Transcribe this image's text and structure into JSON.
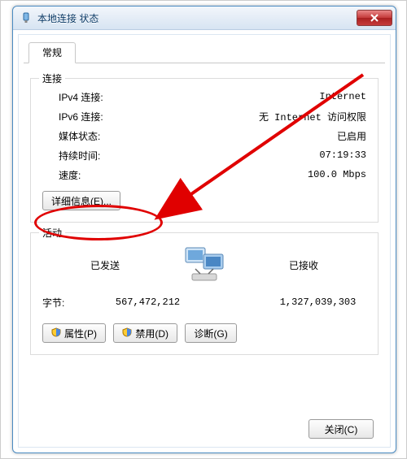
{
  "window": {
    "title": "本地连接 状态"
  },
  "tabs": {
    "general": "常规"
  },
  "connection": {
    "group_title": "连接",
    "ipv4_label": "IPv4 连接:",
    "ipv4_value": "Internet",
    "ipv6_label": "IPv6 连接:",
    "ipv6_value": "无 Internet 访问权限",
    "media_label": "媒体状态:",
    "media_value": "已启用",
    "duration_label": "持续时间:",
    "duration_value": "07:19:33",
    "speed_label": "速度:",
    "speed_value": "100.0 Mbps",
    "details_button": "详细信息(E)..."
  },
  "activity": {
    "group_title": "活动",
    "sent_label": "已发送",
    "recv_label": "已接收",
    "bytes_label": "字节:",
    "sent_value": "567,472,212",
    "recv_value": "1,327,039,303"
  },
  "buttons": {
    "properties": "属性(P)",
    "disable": "禁用(D)",
    "diagnose": "诊断(G)",
    "close": "关闭(C)"
  },
  "annotation": {
    "target": "details-button",
    "color": "#e00000"
  }
}
